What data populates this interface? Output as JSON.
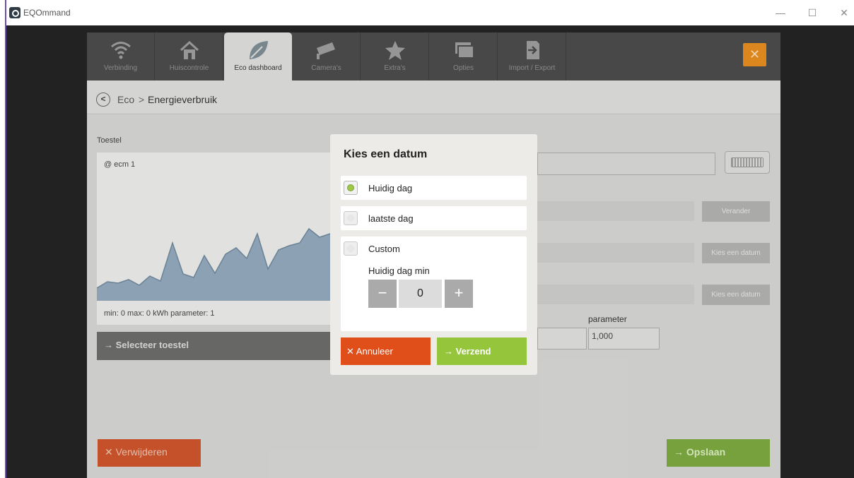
{
  "window": {
    "title": "EQOmmand",
    "minimize_glyph": "—",
    "maximize_glyph": "☐",
    "close_glyph": "✕"
  },
  "tabs": [
    {
      "label": "Verbinding",
      "icon": "wifi-icon"
    },
    {
      "label": "Huiscontrole",
      "icon": "home-icon"
    },
    {
      "label": "Eco dashboard",
      "icon": "leaf-icon"
    },
    {
      "label": "Camera's",
      "icon": "camera-icon"
    },
    {
      "label": "Extra's",
      "icon": "star-icon"
    },
    {
      "label": "Opties",
      "icon": "windows-icon"
    },
    {
      "label": "Import / Export",
      "icon": "import-export-icon"
    }
  ],
  "active_tab": "Eco dashboard",
  "app_close_glyph": "✕",
  "breadcrumb": {
    "back_glyph": "<",
    "parent": "Eco",
    "separator": ">",
    "current": "Energieverbruik"
  },
  "device": {
    "section_label": "Toestel",
    "name": "@ ecm 1",
    "stats": "min: 0 max: 0 kWh parameter: 1",
    "select_label": "→  Selecteer toestel"
  },
  "right_panel": {
    "change_button": "Verander",
    "pick_date_button_1": "Kies een datum",
    "pick_date_button_2": "Kies een datum",
    "parameter_label": "parameter",
    "parameter_value": "1,000"
  },
  "footer": {
    "delete_label": "✕  Verwijderen",
    "save_label": "→  Opslaan"
  },
  "modal": {
    "title": "Kies een datum",
    "options": [
      {
        "label": "Huidig dag",
        "selected": true
      },
      {
        "label": "laatste dag",
        "selected": false
      },
      {
        "label": "Custom",
        "selected": false
      }
    ],
    "custom_min_label": "Huidig dag min",
    "stepper": {
      "minus": "−",
      "value": "0",
      "plus": "+"
    },
    "cancel_label": "✕  Annuleer",
    "send_label": "→  Verzend"
  },
  "colors": {
    "tabbar": "#4a4a4a",
    "orange_close": "#e08a1e",
    "cancel": "#e04e1a",
    "send": "#94c53a",
    "chart_fill": "#8fa6b8"
  }
}
